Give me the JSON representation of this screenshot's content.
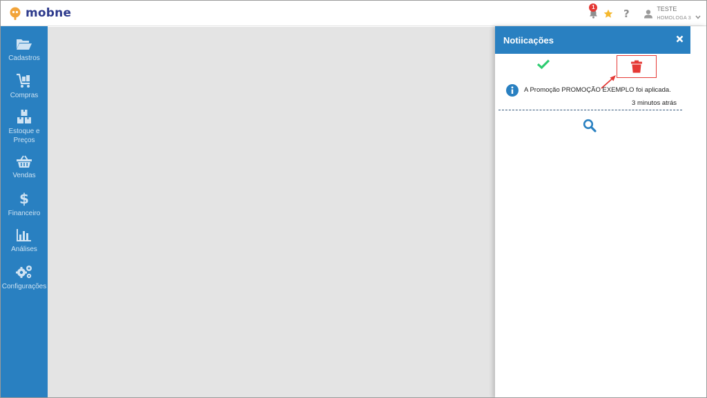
{
  "app": {
    "brand": "mobne",
    "colors": {
      "primary": "#2980c1",
      "brand_text": "#2d3a8c",
      "logo": "#f2a43a",
      "danger": "#e53935",
      "success": "#2ecc71"
    }
  },
  "topbar": {
    "notification_count": "1",
    "icons": [
      "bell-icon",
      "star-icon",
      "help-icon",
      "user-icon",
      "chevron-down-icon"
    ],
    "help_label": "?",
    "user": {
      "name": "TESTE",
      "org": "HOMOLOGA 3"
    }
  },
  "sidebar": {
    "items": [
      {
        "label": "Cadastros",
        "icon": "folder-open-icon"
      },
      {
        "label": "Compras",
        "icon": "cart-icon"
      },
      {
        "label": "Estoque e Preços",
        "icon": "boxes-icon"
      },
      {
        "label": "Vendas",
        "icon": "basket-icon"
      },
      {
        "label": "Financeiro",
        "icon": "dollar-icon"
      },
      {
        "label": "Análises",
        "icon": "bar-chart-icon"
      },
      {
        "label": "Configurações",
        "icon": "gears-icon"
      }
    ]
  },
  "notifications": {
    "title": "Notiicações",
    "actions": {
      "mark_read_icon": "check-icon",
      "delete_icon": "trash-icon",
      "more_icon": "search-icon"
    },
    "items": [
      {
        "message": "A Promoção PROMOÇÃO EXEMPLO foi aplicada.",
        "time": "3 minutos atrás",
        "icon": "info-icon"
      }
    ]
  }
}
